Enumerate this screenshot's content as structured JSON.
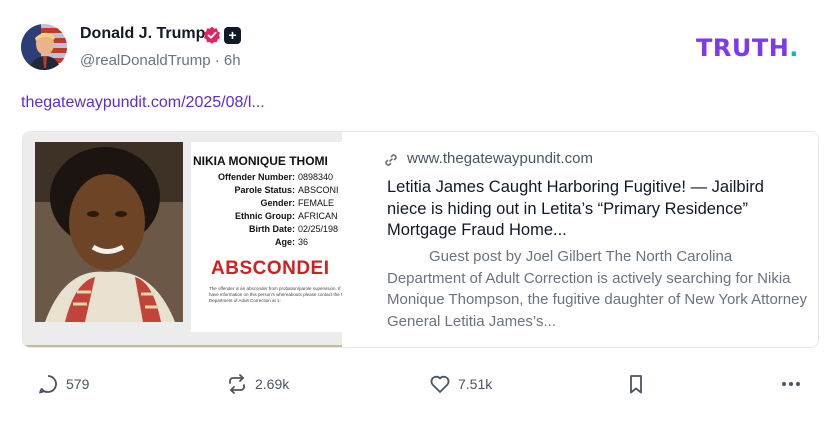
{
  "author": {
    "name": "Donald J. Trump",
    "handle": "@realDonaldTrump",
    "time": "· 6h",
    "plus_badge": "+"
  },
  "logo": {
    "text": "TRUTH",
    "dot": ".",
    "colors": {
      "main": "#7c3aed",
      "dot": "#14b8a6"
    }
  },
  "post": {
    "link_text": "thegatewaypundit.com/2025/08/l..."
  },
  "card": {
    "domain": "www.thegatewaypundit.com",
    "title": "Letitia James Caught Harboring Fugitive! — Jailbird niece is hiding out in Letita’s “Primary Residence” Mortgage Fraud Home...",
    "description": "Guest post by Joel Gilbert The North Carolina Department of Adult Correction is actively searching for Nikia Monique Thompson, the fugitive daughter of New York Attorney General Letitia James’s...",
    "image": {
      "name": "NIKIA MONIQUE THOMI",
      "rows": [
        {
          "key": "Offender Number:",
          "value": "0898340"
        },
        {
          "key": "Parole Status:",
          "value": "ABSCONI"
        },
        {
          "key": "Gender:",
          "value": "FEMALE"
        },
        {
          "key": "Ethnic Group:",
          "value": "AFRICAN"
        },
        {
          "key": "Birth Date:",
          "value": "02/25/198"
        },
        {
          "key": "Age:",
          "value": "36"
        }
      ],
      "status_stamp": "ABSCONDEI",
      "fine_print": "The offender is an absconder from probation/parole supervision. If you have information on this person's whereabouts please contact the NC Department of Adult Correction at 1-"
    }
  },
  "actions": {
    "replies": "579",
    "retruths": "2.69k",
    "likes": "7.51k"
  },
  "icons": {
    "verified": "verified-badge-icon",
    "reply": "reply-bubble-icon",
    "retruth": "retruth-arrows-icon",
    "like": "heart-icon",
    "save": "bookmark-icon",
    "more": "more-dots-icon",
    "link": "link-chain-icon"
  },
  "colors": {
    "link": "#5b2bd8",
    "verified": "#e0245e",
    "stamp": "#d11f1f"
  }
}
